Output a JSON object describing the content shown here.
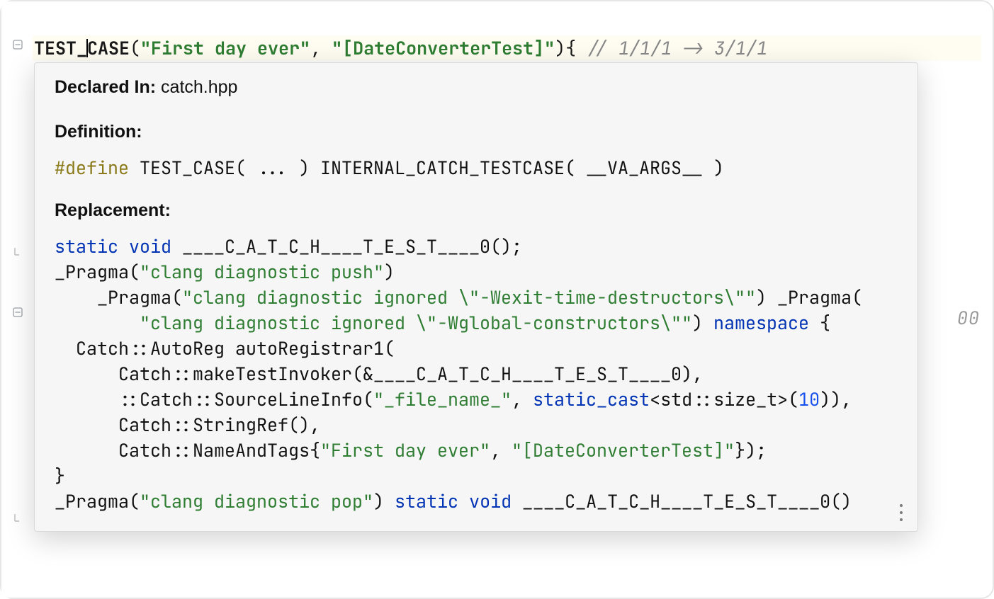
{
  "editor": {
    "code_line": {
      "keyword_before_caret": "TEST_",
      "keyword_after_caret": "CASE",
      "open_paren": "(",
      "string1": "\"First day ever\"",
      "comma_space": ", ",
      "string2": "\"[DateConverterTest]\"",
      "close": "){ ",
      "comment": "// 1/1/1 -> 3/1/1"
    },
    "hidden_fragment": "00"
  },
  "popup": {
    "declared_in_label": "Declared In:",
    "declared_in_value": " catch.hpp",
    "definition_label": "Definition:",
    "definition_code": {
      "directive": "#define",
      "rest": " TEST_CASE( ... ) INTERNAL_CATCH_TESTCASE( __VA_ARGS__ )"
    },
    "replacement_label": "Replacement:",
    "replacement": {
      "l1_kw1": "static",
      "l1_sp1": " ",
      "l1_kw2": "void",
      "l1_rest": " ____C_A_T_C_H____T_E_S_T____0();",
      "l2_pre": "_Pragma(",
      "l2_str": "\"clang diagnostic push\"",
      "l2_post": ")",
      "l3_pre": "    _Pragma(",
      "l3_str": "\"clang diagnostic ignored \\\"-Wexit-time-destructors\\\"\"",
      "l3_post": ") _Pragma(",
      "l4_pre": "        ",
      "l4_str": "\"clang diagnostic ignored \\\"-Wglobal-constructors\\\"\"",
      "l4_post": ") ",
      "l4_kw": "namespace",
      "l4_end": " {",
      "l5": "  Catch::AutoReg autoRegistrar1(",
      "l6": "      Catch::makeTestInvoker(&____C_A_T_C_H____T_E_S_T____0),",
      "l7_pre": "      ::Catch::SourceLineInfo(",
      "l7_str": "\"_file_name_\"",
      "l7_mid": ", ",
      "l7_kw": "static_cast",
      "l7_after": "<std::size_t>(",
      "l7_num": "10",
      "l7_end": ")),",
      "l8": "      Catch::StringRef(),",
      "l9_pre": "      Catch::NameAndTags{",
      "l9_str1": "\"First day ever\"",
      "l9_mid": ", ",
      "l9_str2": "\"[DateConverterTest]\"",
      "l9_end": "});",
      "l10": "}",
      "l11_pre": "_Pragma(",
      "l11_str": "\"clang diagnostic pop\"",
      "l11_post": ") ",
      "l11_kw1": "static",
      "l11_sp": " ",
      "l11_kw2": "void",
      "l11_rest": " ____C_A_T_C_H____T_E_S_T____0()"
    }
  }
}
